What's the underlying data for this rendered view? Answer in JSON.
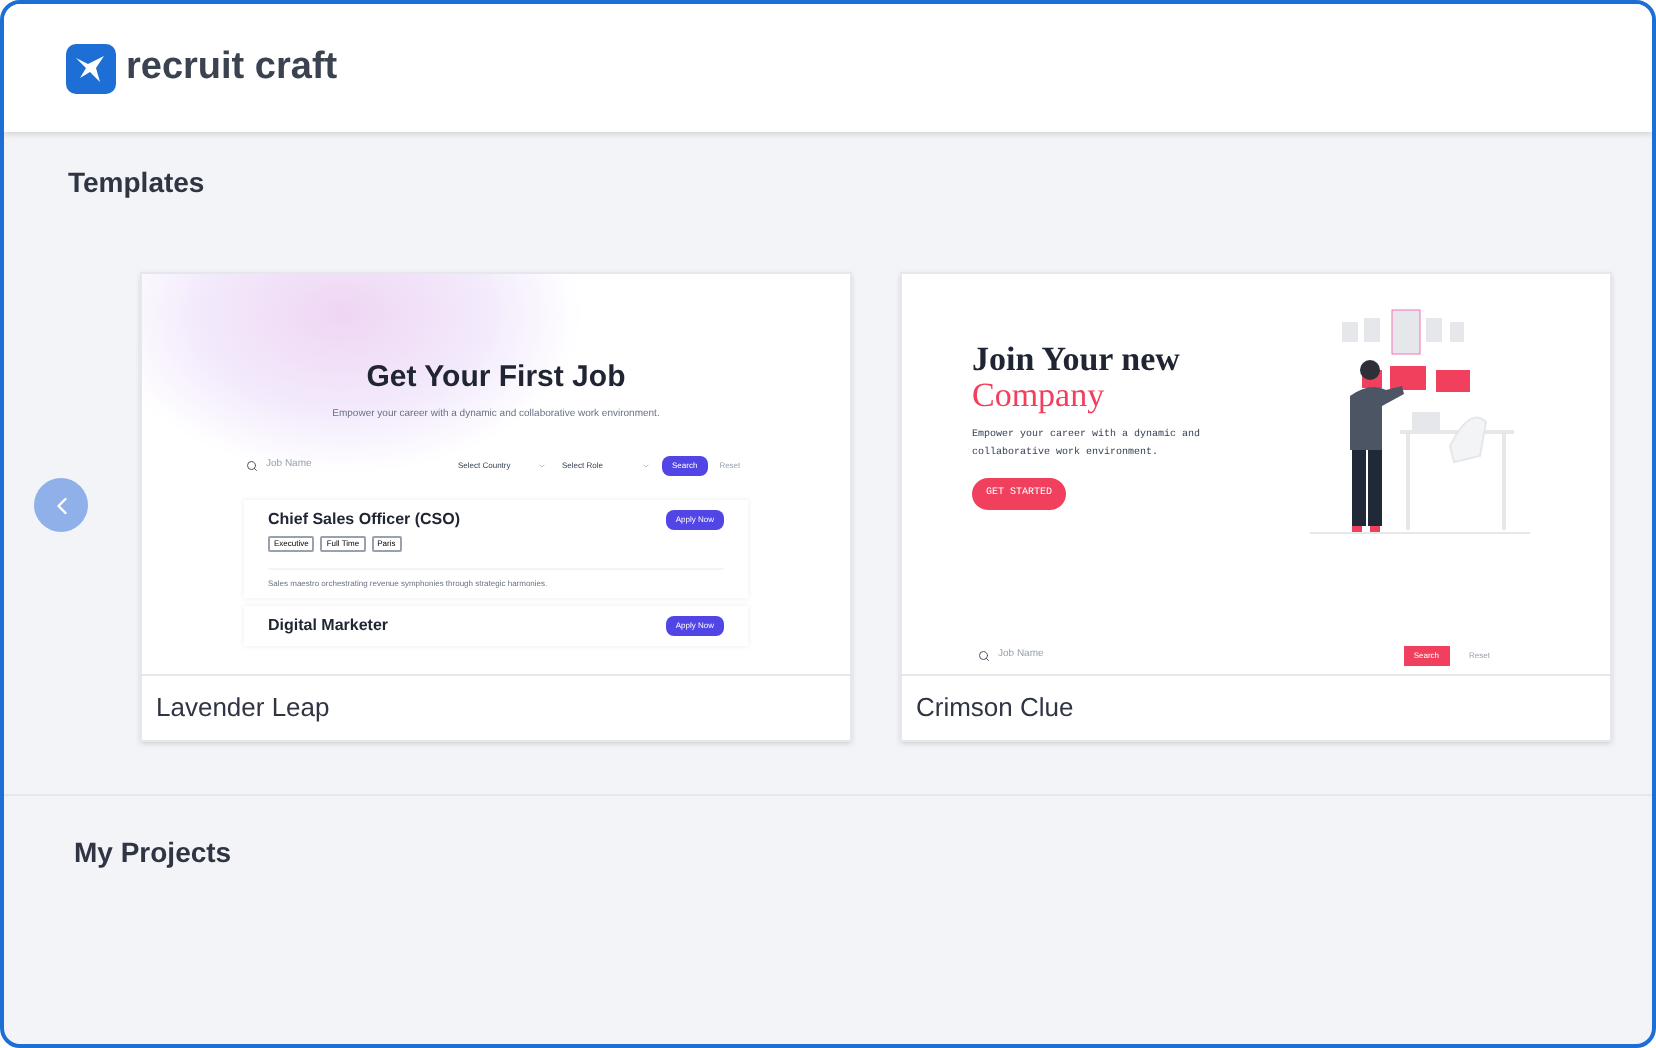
{
  "header": {
    "brand": "recruit craft"
  },
  "templates_section": {
    "title": "Templates",
    "templates": [
      {
        "name": "Lavender Leap",
        "preview": {
          "kind": "job-board",
          "title": "Get Your First Job",
          "subtitle": "Empower your career with a dynamic and collaborative work environment.",
          "search_placeholder": "Job Name",
          "selects": [
            "Select Country",
            "Select Role"
          ],
          "search_button": "Search",
          "reset": "Reset",
          "jobs": [
            {
              "title": "Chief Sales Officer (CSO)",
              "tags": [
                "Executive",
                "Full Time",
                "Paris"
              ],
              "description": "Sales maestro orchestrating revenue symphonies through strategic harmonies.",
              "button": "Apply Now"
            },
            {
              "title": "Digital Marketer",
              "button": "Apply Now"
            }
          ]
        }
      },
      {
        "name": "Crimson Clue",
        "preview": {
          "kind": "hero",
          "title": "Join Your new",
          "title_accent": "Company",
          "subtitle": "Empower your career with a dynamic and collaborative work environment.",
          "cta": "GET STARTED",
          "search_placeholder": "Job Name",
          "search_button": "Search",
          "reset": "Reset"
        }
      }
    ]
  },
  "projects_section": {
    "title": "My Projects"
  }
}
